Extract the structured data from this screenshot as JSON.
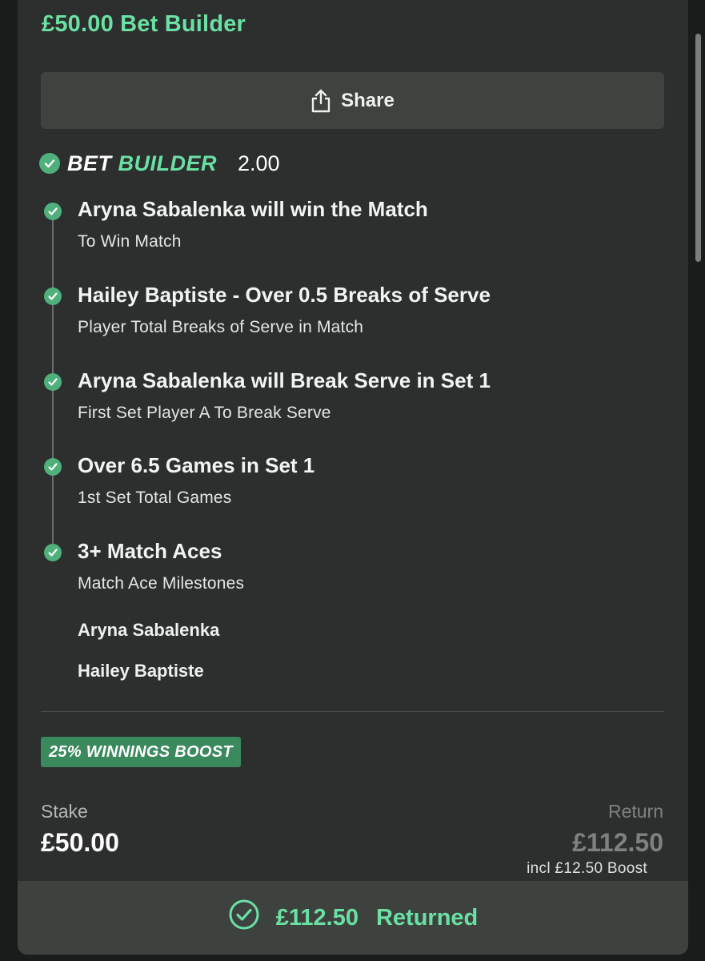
{
  "bet": {
    "title": "£50.00 Bet Builder"
  },
  "share": {
    "label": "Share",
    "icon": "share-icon"
  },
  "bet_builder": {
    "logo_part1": "BET",
    "logo_part2": "BUILDER",
    "odds": "2.00",
    "legs": [
      {
        "selection": "Aryna Sabalenka will win the Match",
        "market": "To Win Match"
      },
      {
        "selection": "Hailey Baptiste - Over 0.5 Breaks of Serve",
        "market": "Player Total Breaks of Serve in Match"
      },
      {
        "selection": "Aryna Sabalenka will Break Serve in Set 1",
        "market": "First Set Player A To Break Serve"
      },
      {
        "selection": "Over 6.5 Games in Set 1",
        "market": "1st Set Total Games"
      },
      {
        "selection": "3+ Match Aces",
        "market": "Match Ace Milestones"
      }
    ],
    "players": [
      "Aryna Sabalenka",
      "Hailey Baptiste"
    ]
  },
  "boost": {
    "label": "25% WINNINGS BOOST"
  },
  "stake": {
    "label": "Stake",
    "value": "£50.00"
  },
  "return": {
    "label": "Return",
    "value": "£112.50",
    "boost_note": "incl £12.50 Boost"
  },
  "result": {
    "amount": "£112.50",
    "status": "Returned"
  },
  "colors": {
    "accent": "#6be0a4",
    "check": "#4fb07b",
    "boost_badge": "#3a8a5d",
    "card": "#2c2f2d",
    "button": "#3f4340"
  }
}
